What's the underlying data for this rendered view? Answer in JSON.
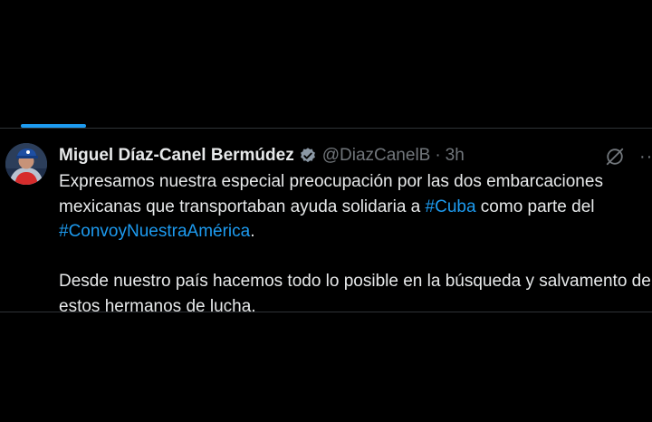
{
  "tweet": {
    "author_name": "Miguel Díaz-Canel Bermúdez",
    "handle": "@DiazCanelB",
    "separator": "·",
    "time": "3h",
    "more_label": "···",
    "paragraph1": {
      "text_a": "Expresamos nuestra especial preocupación por las dos embarcaciones mexicanas que transportaban ayuda solidaria a ",
      "hashtag1": "#Cuba",
      "text_b": " como parte del ",
      "hashtag2": "#ConvoyNuestraAmérica",
      "text_c": "."
    },
    "paragraph2": "Desde nuestro país hacemos todo lo posible en la búsqueda y salvamento de estos hermanos de lucha."
  },
  "colors": {
    "background": "#000000",
    "text": "#e7e9ea",
    "muted": "#71767b",
    "accent": "#1d9bf0",
    "divider": "#2f3336"
  },
  "icons": {
    "verified": "verified-badge-icon",
    "grok": "grok-icon",
    "more": "more-icon"
  }
}
